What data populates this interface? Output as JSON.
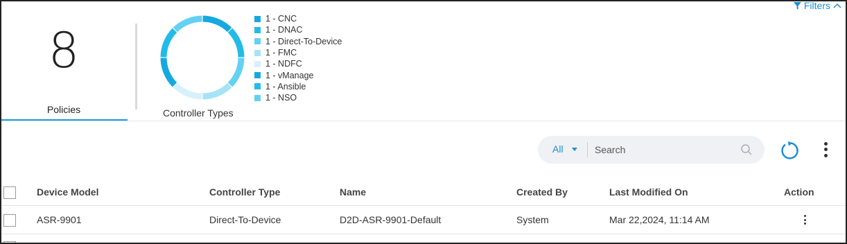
{
  "filters": {
    "label": "Filters"
  },
  "summary": {
    "count": "8",
    "label": "Policies"
  },
  "controller_types": {
    "label": "Controller Types",
    "legend": [
      {
        "text": "1 - CNC",
        "color": "#15a9df"
      },
      {
        "text": "1 - DNAC",
        "color": "#22bbe8"
      },
      {
        "text": "1 - Direct-To-Device",
        "color": "#63d1f1"
      },
      {
        "text": "1 - FMC",
        "color": "#a5e4f6"
      },
      {
        "text": "1 - NDFC",
        "color": "#d7f1fa"
      },
      {
        "text": "1 - vManage",
        "color": "#15a9df"
      },
      {
        "text": "1 - Ansible",
        "color": "#22bbe8"
      },
      {
        "text": "1 - NSO",
        "color": "#63d1f1"
      }
    ]
  },
  "toolbar": {
    "scope_value": "All",
    "search_placeholder": "Search"
  },
  "table": {
    "columns": [
      "Device Model",
      "Controller Type",
      "Name",
      "Created By",
      "Last Modified On",
      "Action"
    ],
    "rows": [
      {
        "device_model": "ASR-9901",
        "controller_type": "Direct-To-Device",
        "name": "D2D-ASR-9901-Default",
        "created_by": "System",
        "last_modified": "Mar 22,2024, 11:14 AM"
      }
    ]
  },
  "colors": {
    "accent": "#1b8fd1",
    "underline": "#1b9dd9"
  }
}
